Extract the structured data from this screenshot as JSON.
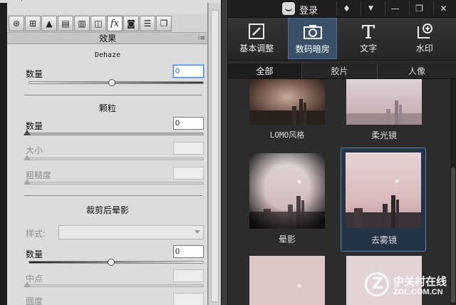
{
  "left_panel": {
    "tool_tabs": [
      {
        "icon": "aperture-icon",
        "glyph": "⊛"
      },
      {
        "icon": "curve-icon",
        "glyph": "⊞"
      },
      {
        "icon": "mountain-icon",
        "glyph": "▲"
      },
      {
        "icon": "split-toning-icon",
        "glyph": "▤"
      },
      {
        "icon": "detail-icon",
        "glyph": "▥"
      },
      {
        "icon": "lens-icon",
        "glyph": "◫"
      },
      {
        "icon": "fx-icon",
        "glyph": "fx"
      },
      {
        "icon": "camera-icon",
        "glyph": "◙"
      },
      {
        "icon": "presets-icon",
        "glyph": "☰"
      },
      {
        "icon": "snapshots-icon",
        "glyph": "❐"
      }
    ],
    "section_title": "效果",
    "dehaze": {
      "title": "Dehaze",
      "amount_label": "数量",
      "amount_value": "0"
    },
    "grain": {
      "title": "颗粒",
      "amount_label": "数量",
      "amount_value": "0",
      "size_label": "大小",
      "roughness_label": "粗糙度"
    },
    "vignette": {
      "title": "裁剪后晕影",
      "style_label": "样式:",
      "amount_label": "数量",
      "amount_value": "0",
      "midpoint_label": "中点",
      "roundness_label": "圆度"
    }
  },
  "right_panel": {
    "login_label": "登录",
    "window_buttons": [
      {
        "icon": "shirt-icon",
        "glyph": "♦"
      },
      {
        "icon": "dropdown-icon",
        "glyph": "▼"
      },
      {
        "icon": "minimize-icon",
        "glyph": "—"
      },
      {
        "icon": "restore-icon",
        "glyph": "❐"
      },
      {
        "icon": "close-icon",
        "glyph": "✕"
      }
    ],
    "tools": [
      {
        "label": "基本调整",
        "icon": "edit-icon"
      },
      {
        "label": "数码暗房",
        "icon": "camera-icon"
      },
      {
        "label": "文字",
        "icon": "text-icon"
      },
      {
        "label": "水印",
        "icon": "watermark-icon"
      }
    ],
    "sub_tabs": [
      "全部",
      "胶片",
      "人像"
    ],
    "filters": [
      {
        "caption": "LOMO风格",
        "tone": "lomo"
      },
      {
        "caption": "柔光镜",
        "tone": "soft"
      },
      {
        "caption": "晕影",
        "tone": "vignette"
      },
      {
        "caption": "去雾镜",
        "tone": "dehaze"
      },
      {
        "caption": "",
        "tone": "plain"
      },
      {
        "caption": "",
        "tone": "plain"
      }
    ]
  },
  "watermark": {
    "cn": "中关村在线",
    "en": "ZOL.COM.CN"
  }
}
